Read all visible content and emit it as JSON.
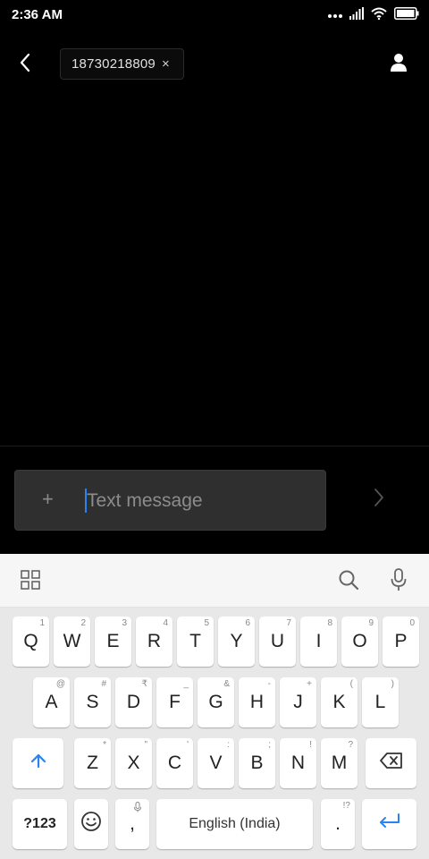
{
  "status_bar": {
    "time": "2:36 AM",
    "icons": [
      "more-dots-icon",
      "signal-icon",
      "wifi-icon",
      "battery-icon"
    ]
  },
  "header": {
    "recipient": "18730218809",
    "remove_symbol": "×"
  },
  "compose": {
    "placeholder": "Text message",
    "attach_symbol": "+"
  },
  "keyboard": {
    "row1": [
      {
        "label": "Q",
        "hint": "1"
      },
      {
        "label": "W",
        "hint": "2"
      },
      {
        "label": "E",
        "hint": "3"
      },
      {
        "label": "R",
        "hint": "4"
      },
      {
        "label": "T",
        "hint": "5"
      },
      {
        "label": "Y",
        "hint": "6"
      },
      {
        "label": "U",
        "hint": "7"
      },
      {
        "label": "I",
        "hint": "8"
      },
      {
        "label": "O",
        "hint": "9"
      },
      {
        "label": "P",
        "hint": "0"
      }
    ],
    "row2": [
      {
        "label": "A",
        "hint": "@"
      },
      {
        "label": "S",
        "hint": "#"
      },
      {
        "label": "D",
        "hint": "₹"
      },
      {
        "label": "F",
        "hint": "_"
      },
      {
        "label": "G",
        "hint": "&"
      },
      {
        "label": "H",
        "hint": "-"
      },
      {
        "label": "J",
        "hint": "+"
      },
      {
        "label": "K",
        "hint": "("
      },
      {
        "label": "L",
        "hint": ")"
      }
    ],
    "row3": [
      {
        "label": "Z",
        "hint": "*"
      },
      {
        "label": "X",
        "hint": "\""
      },
      {
        "label": "C",
        "hint": "'"
      },
      {
        "label": "V",
        "hint": ":"
      },
      {
        "label": "B",
        "hint": ";"
      },
      {
        "label": "N",
        "hint": "!"
      },
      {
        "label": "M",
        "hint": "?"
      }
    ],
    "symbols_label": "?123",
    "comma": ",",
    "space_label": "English (India)",
    "period": ".",
    "period_hint": "!?"
  },
  "colors": {
    "accent": "#2a83f0",
    "keyboard_bg": "#e8e8e8",
    "key_bg": "#ffffff"
  }
}
